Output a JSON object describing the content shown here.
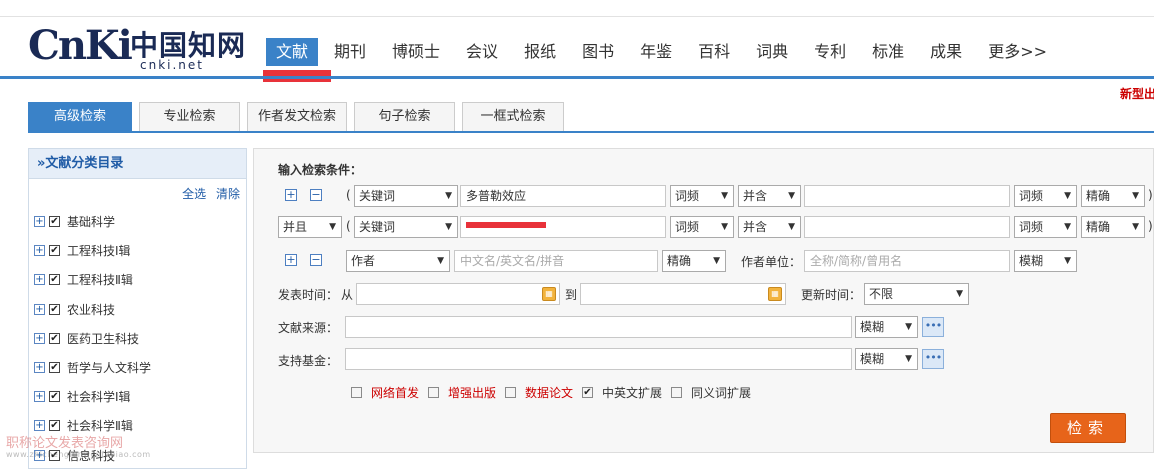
{
  "logo": {
    "cnki_text": "CnKi",
    "cn_text": "中国知网",
    "url_text": "cnki.net"
  },
  "nav": [
    "文献",
    "期刊",
    "博硕士",
    "会议",
    "报纸",
    "图书",
    "年鉴",
    "百科",
    "词典",
    "专利",
    "标准",
    "成果",
    "更多>>"
  ],
  "new_type_text": "新型出",
  "tabs": [
    "高级检索",
    "专业检索",
    "作者发文检索",
    "句子检索",
    "一框式检索"
  ],
  "sidebar": {
    "title": "»文献分类目录",
    "select_all": "全选",
    "clear": "清除",
    "categories": [
      "基础科学",
      "工程科技Ⅰ辑",
      "工程科技Ⅱ辑",
      "农业科技",
      "医药卫生科技",
      "哲学与人文科学",
      "社会科学Ⅰ辑",
      "社会科学Ⅱ辑",
      "信息科技"
    ]
  },
  "form": {
    "heading": "输入检索条件：",
    "row1": {
      "field": "关键词",
      "value": "多普勒效应",
      "freq": "词频",
      "logic": "并含",
      "freq2": "词频",
      "match": "精确"
    },
    "row2": {
      "logic": "并且",
      "field": "关键词",
      "freq": "词频",
      "logic2": "并含",
      "freq2": "词频",
      "match": "精确"
    },
    "row3": {
      "field": "作者",
      "placeholder": "中文名/英文名/拼音",
      "match": "精确",
      "org_label": "作者单位：",
      "org_placeholder": "全称/简称/曾用名",
      "org_match": "模糊"
    },
    "date": {
      "label": "发表时间：",
      "from": "从",
      "to": "到",
      "update_label": "更新时间：",
      "update_value": "不限"
    },
    "source": {
      "label": "文献来源：",
      "match": "模糊"
    },
    "fund": {
      "label": "支持基金：",
      "match": "模糊"
    },
    "options": [
      {
        "label": "网络首发",
        "checked": false,
        "color": "#c00"
      },
      {
        "label": "增强出版",
        "checked": false,
        "color": "#c00"
      },
      {
        "label": "数据论文",
        "checked": false,
        "color": "#c00"
      },
      {
        "label": "中英文扩展",
        "checked": true,
        "color": "#333"
      },
      {
        "label": "同义词扩展",
        "checked": false,
        "color": "#333"
      }
    ],
    "search_button": "检索"
  },
  "watermark": {
    "text": "职称论文发表咨询网",
    "url": "www.zhichenglunwenfabiao.com"
  },
  "colors": {
    "accent": "#3a82c8",
    "search_button": "#e7641a",
    "annotation": "#e8323a"
  }
}
